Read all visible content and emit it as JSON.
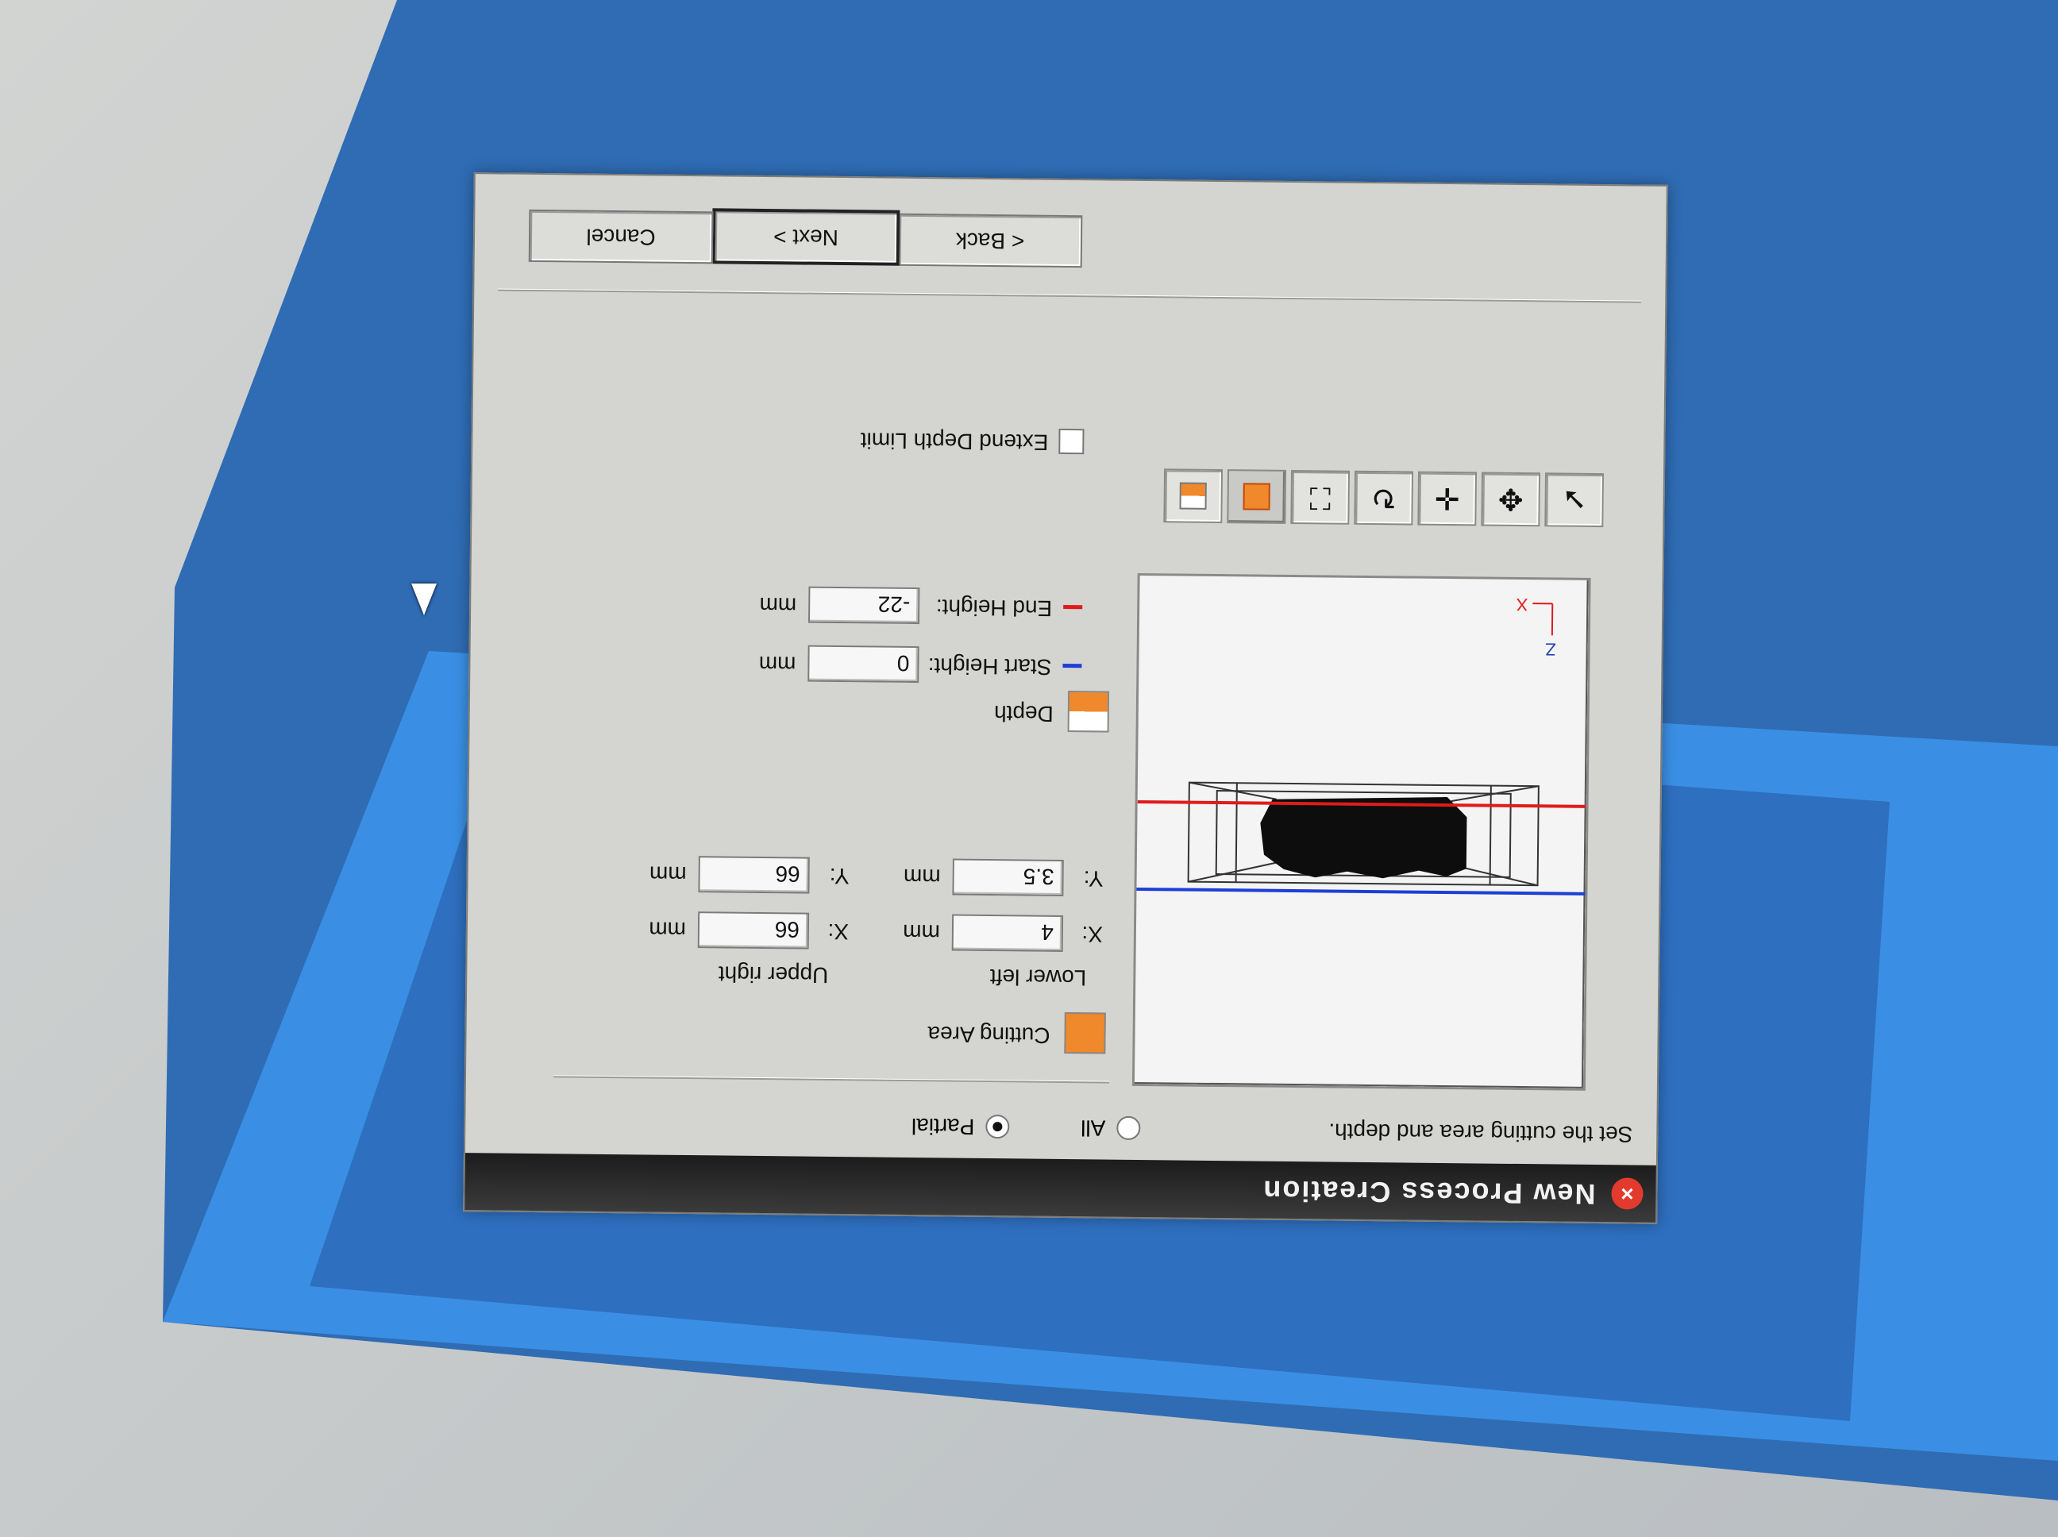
{
  "window": {
    "title": "New Process Creation",
    "close_icon": "close-icon"
  },
  "instruction": "Set the cutting area and depth.",
  "range_mode": {
    "options": [
      {
        "label": "All",
        "selected": false
      },
      {
        "label": "Partial",
        "selected": true
      }
    ]
  },
  "preview": {
    "axis_z": "Z",
    "axis_x": "X",
    "start_line_color": "#1c3fd6",
    "end_line_color": "#e01b1b"
  },
  "toolbar": {
    "tools": [
      "select-arrow-icon",
      "pan-3d-icon",
      "move-icon",
      "rotate-icon",
      "fit-view-icon",
      "cutting-area-icon",
      "depth-icon"
    ]
  },
  "cutting_area": {
    "label": "Cutting Area",
    "lower_left": {
      "label": "Lower left",
      "x_label": "X:",
      "x": "4",
      "y_label": "Y:",
      "y": "3.5",
      "unit": "mm"
    },
    "upper_right": {
      "label": "Upper right",
      "x_label": "X:",
      "x": "66",
      "y_label": "Y:",
      "y": "66",
      "unit": "mm"
    }
  },
  "depth": {
    "label": "Depth",
    "start_height": {
      "label": "Start Height:",
      "value": "0",
      "unit": "mm"
    },
    "end_height": {
      "label": "End Height:",
      "value": "-22",
      "unit": "mm"
    },
    "accent_orange": "#f0892b"
  },
  "extend_depth_limit": {
    "label": "Extend Depth Limit",
    "checked": false
  },
  "buttons": {
    "back": "< Back",
    "next": "Next >",
    "cancel": "Cancel"
  }
}
